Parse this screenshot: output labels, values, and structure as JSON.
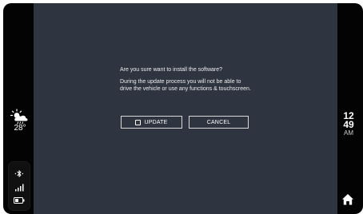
{
  "weather": {
    "icon": "partly-cloudy-rain-icon",
    "temperature": "28°"
  },
  "status": {
    "bluetooth_icon": "bluetooth-icon",
    "signal_icon": "signal-bars-icon",
    "battery_icon": "battery-icon"
  },
  "clock": {
    "hour": "12",
    "minute": "49",
    "ampm": "AM"
  },
  "dialog": {
    "question": "Are you sure want to install the software?",
    "message": "During the update process you will not be able to drive the vehicle or use any functions & touchscreen.",
    "update_label": "UPDATE",
    "cancel_label": "CANCEL"
  },
  "nav": {
    "home_icon": "home-icon"
  },
  "colors": {
    "background": "#2e3540",
    "bezel": "#030303",
    "text": "#ffffff"
  }
}
